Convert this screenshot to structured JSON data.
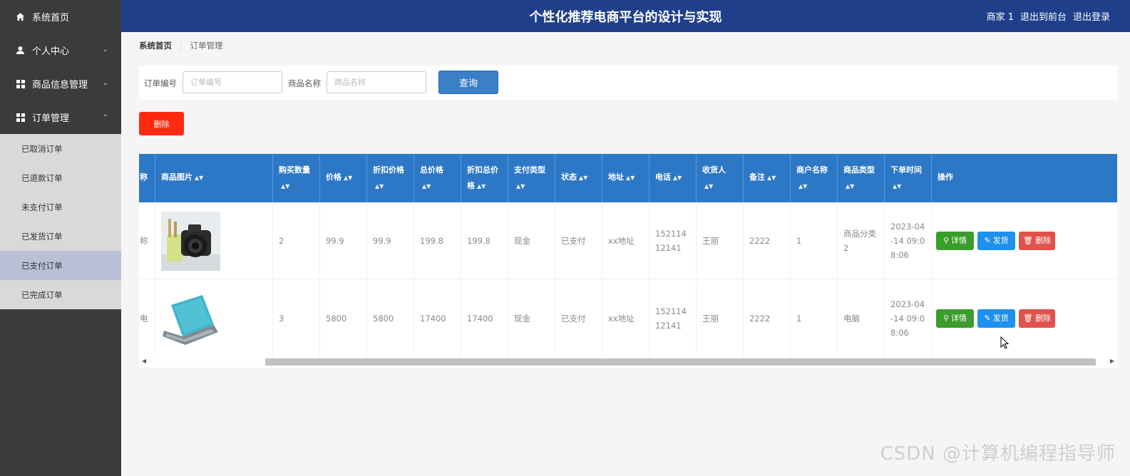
{
  "app": {
    "title": "个性化推荐电商平台的设计与实现",
    "user": "商家 1",
    "goto_front": "退出到前台",
    "logout": "退出登录"
  },
  "sidebar": {
    "items": [
      {
        "label": "系统首页",
        "icon": "home-icon"
      },
      {
        "label": "个人中心",
        "icon": "user-icon"
      },
      {
        "label": "商品信息管理",
        "icon": "grid-icon"
      },
      {
        "label": "订单管理",
        "icon": "grid-icon"
      }
    ],
    "sub_items": [
      "已取消订单",
      "已退款订单",
      "未支付订单",
      "已发货订单",
      "已支付订单",
      "已完成订单"
    ]
  },
  "breadcrumb": {
    "home": "系统首页",
    "current": "订单管理"
  },
  "search": {
    "order_no_label": "订单编号",
    "order_no_placeholder": "订单编号",
    "product_name_label": "商品名称",
    "product_name_placeholder": "商品名称",
    "query_button": "查询"
  },
  "delete_button": "删除",
  "table": {
    "headers": {
      "name": "称",
      "image": "商品图片",
      "qty": "购买数量",
      "price": "价格",
      "discount_price": "折扣价格",
      "total": "总价格",
      "discount_total": "折扣总价格",
      "pay_type": "支付类型",
      "status": "状态",
      "address": "地址",
      "phone": "电话",
      "receiver": "收货人",
      "remark": "备注",
      "merchant": "商户名称",
      "category": "商品类型",
      "time": "下单时间",
      "ops": "操作"
    },
    "rows": [
      {
        "name": "称",
        "image": "camera",
        "qty": "2",
        "price": "99.9",
        "discount_price": "99.9",
        "total": "199.8",
        "discount_total": "199.8",
        "pay_type": "现金",
        "status": "已支付",
        "address": "xx地址",
        "phone": "15211412141",
        "receiver": "王丽",
        "remark": "2222",
        "merchant": "1",
        "category": "商品分类2",
        "time": "2023-04-14 09:08:06"
      },
      {
        "name": "电",
        "image": "laptop",
        "qty": "3",
        "price": "5800",
        "discount_price": "5800",
        "total": "17400",
        "discount_total": "17400",
        "pay_type": "现金",
        "status": "已支付",
        "address": "xx地址",
        "phone": "15211412141",
        "receiver": "王丽",
        "remark": "2222",
        "merchant": "1",
        "category": "电脑",
        "time": "2023-04-14 09:08:06"
      }
    ],
    "ops": {
      "detail": "详情",
      "ship": "发货",
      "delete": "删除"
    }
  },
  "watermark": "CSDN @计算机编程指导师",
  "colors": {
    "header": "#1f3f8a",
    "sidebar": "#3b3b3b",
    "table_header": "#2d78c6",
    "danger": "#ff2a10"
  }
}
